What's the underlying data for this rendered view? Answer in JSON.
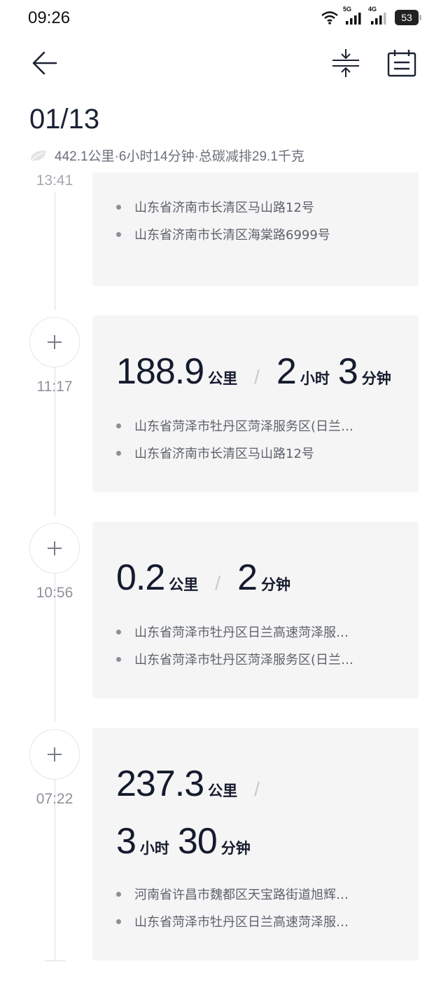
{
  "status_bar": {
    "time": "09:26",
    "network1": "5G",
    "network2": "4G",
    "battery": "53"
  },
  "header": {
    "date": "01/13",
    "summary": "442.1公里·6小时14分钟·总碳减排29.1千克"
  },
  "icons": {
    "back": "arrow-left-icon",
    "collapse": "collapse-vertical-icon",
    "calendar": "calendar-icon",
    "leaf": "leaf-icon",
    "add": "plus-icon"
  },
  "trips": [
    {
      "time": "13:41",
      "distance": "",
      "distance_unit": "",
      "hours": "",
      "hours_unit": "",
      "minutes": "",
      "minutes_unit": "",
      "from": "山东省济南市长清区马山路12号",
      "to": "山东省济南市长清区海棠路6999号"
    },
    {
      "time": "11:17",
      "distance": "188.9",
      "distance_unit": "公里",
      "hours": "2",
      "hours_unit": "小时",
      "minutes": "3",
      "minutes_unit": "分钟",
      "from": "山东省菏泽市牡丹区菏泽服务区(日兰…",
      "to": "山东省济南市长清区马山路12号"
    },
    {
      "time": "10:56",
      "distance": "0.2",
      "distance_unit": "公里",
      "minutes": "2",
      "minutes_unit": "分钟",
      "from": "山东省菏泽市牡丹区日兰高速菏泽服…",
      "to": "山东省菏泽市牡丹区菏泽服务区(日兰…"
    },
    {
      "time": "07:22",
      "distance": "237.3",
      "distance_unit": "公里",
      "hours": "3",
      "hours_unit": "小时",
      "minutes": "30",
      "minutes_unit": "分钟",
      "from": "河南省许昌市魏都区天宝路街道旭辉…",
      "to": "山东省菏泽市牡丹区日兰高速菏泽服…"
    }
  ],
  "colors": {
    "background": "#ffffff",
    "card": "#f5f5f5",
    "text_primary": "#151b2e",
    "text_secondary": "#6b6f7a",
    "timeline": "#dcdcdc"
  }
}
